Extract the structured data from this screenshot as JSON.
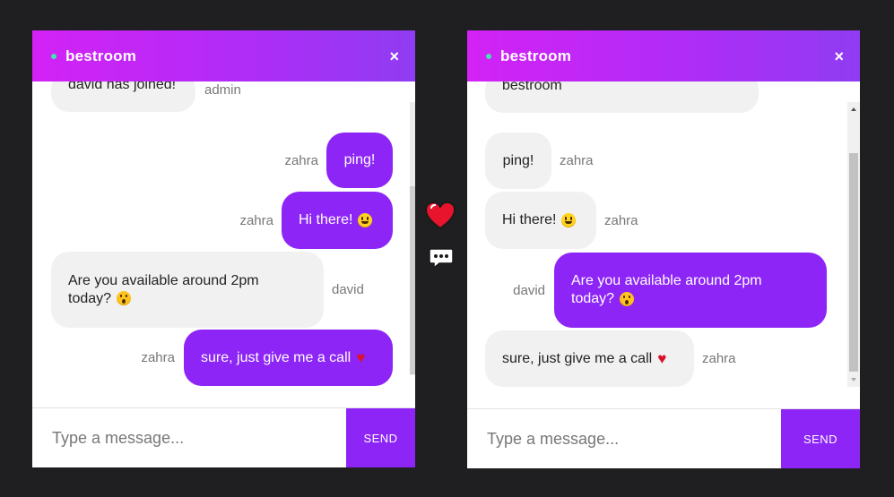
{
  "colors": {
    "background": "#1f1f21",
    "accent": "#8d25f7",
    "header_gradient_start": "#d322f6",
    "header_gradient_end": "#8f3cf2",
    "online_dot": "#3fe4b4",
    "incoming_bubble": "#f1f1f1"
  },
  "left_window": {
    "header": {
      "room_title": "bestroom",
      "close_label": "×"
    },
    "messages": [
      {
        "text": "david has joined!",
        "sender": "admin",
        "mine": false
      },
      {
        "text": "ping!",
        "sender": "zahra",
        "mine": true
      },
      {
        "text": "Hi there!",
        "emoji": "grinning-face",
        "sender": "zahra",
        "mine": true
      },
      {
        "text": "Are you available around 2pm",
        "text_line2": "today?",
        "emoji": "surprised-face",
        "sender": "david",
        "mine": false
      },
      {
        "text": "sure, just give me a call",
        "emoji": "red-heart",
        "sender": "zahra",
        "mine": true
      }
    ],
    "composer": {
      "placeholder": "Type a message...",
      "send_label": "SEND"
    }
  },
  "right_window": {
    "header": {
      "room_title": "bestroom",
      "close_label": "×"
    },
    "messages": [
      {
        "text": "bestroom",
        "sender": "",
        "mine": false
      },
      {
        "text": "ping!",
        "sender": "zahra",
        "mine": false
      },
      {
        "text": "Hi there!",
        "emoji": "grinning-face",
        "sender": "zahra",
        "mine": false
      },
      {
        "text": "Are you available around 2pm",
        "text_line2": "today?",
        "emoji": "surprised-face",
        "sender": "david",
        "mine": true
      },
      {
        "text": "sure, just give me a call",
        "emoji": "red-heart",
        "sender": "zahra",
        "mine": false
      }
    ],
    "composer": {
      "placeholder": "Type a message...",
      "send_label": "SEND"
    }
  },
  "floating_icons": {
    "heart_icon": "red-heart-icon",
    "typing_icon": "speech-bubble-ellipsis-icon"
  }
}
